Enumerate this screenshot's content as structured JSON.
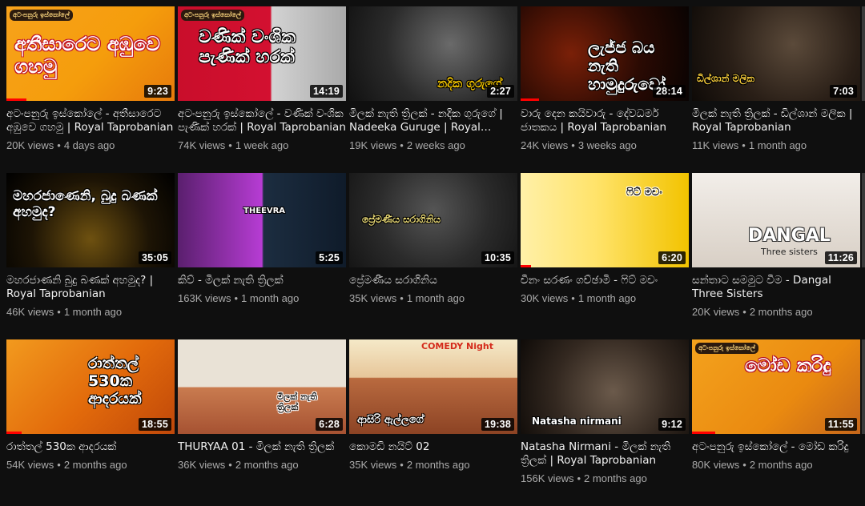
{
  "videos": [
    {
      "title": "අටංපනුරු ඉස්කෝලේ - අතීසාරෙට අඹුවෙ ගහමු | Royal Taprobanian",
      "views": "20K views",
      "age": "4 days ago",
      "duration": "9:23",
      "progress": 0.12,
      "thumb_text": "අතීසාරෙට අඹුවෙ ගහමු",
      "thumb_tag": "අටංපනුරු ඉස්කෝලේ"
    },
    {
      "title": "අටංපනුරු ඉස්කෝලේ - වණික් වංශික පැණික් හරක් | Royal Taprobanian",
      "views": "74K views",
      "age": "1 week ago",
      "duration": "14:19",
      "progress": 0.0,
      "thumb_text": "වණික් වංශික පැණික් හරක්",
      "thumb_tag": "අටංපනුරු ඉස්කෝලේ"
    },
    {
      "title": "මිලක් නැති ත්‍රිලක් - නදික ගුරුගේ | Nadeeka Guruge | Royal Taprobanian",
      "views": "19K views",
      "age": "2 weeks ago",
      "duration": "2:27",
      "progress": 0.0,
      "thumb_text": "නදික ගුරුගේ"
    },
    {
      "title": "වාරු දෙන කයිවාරු - දේවධර්ම ජාතකය | Royal Taprobanian",
      "views": "24K views",
      "age": "3 weeks ago",
      "duration": "28:14",
      "progress": 0.11,
      "thumb_text": "ලැජ්ජ බය නැති හාමුදුරුවෝ"
    },
    {
      "title": "මිලක් නැති ත්‍රිලක් - ඩිල්ශාන් මලික | Royal Taprobanian",
      "views": "11K views",
      "age": "1 month ago",
      "duration": "7:03",
      "progress": 0.0,
      "thumb_text": "ඩිල්ශාන් මලික"
    },
    {
      "title": "මහරජාණනි බුදු බණක් අහමුද? | Royal Taprobanian",
      "views": "46K views",
      "age": "1 month ago",
      "duration": "35:05",
      "progress": 0.0,
      "thumb_text": "මහරජාණෙනි, බුදු බණක් අහමුද?"
    },
    {
      "title": "කිව් - මිලක් නැති ත්‍රිලක්",
      "views": "163K views",
      "age": "1 month ago",
      "duration": "5:25",
      "progress": 0.0,
      "thumb_text": "THEEVRA"
    },
    {
      "title": "ප්‍රේමණීය සරාගිනිය",
      "views": "35K views",
      "age": "1 month ago",
      "duration": "10:35",
      "progress": 0.0,
      "thumb_text": "ප්‍රේමණීය සරාගිනිය"
    },
    {
      "title": "චීනං සරණං ගච්ඡාමි - ෆිට් මචං",
      "views": "30K views",
      "age": "1 month ago",
      "duration": "6:20",
      "progress": 0.06,
      "thumb_text": "ෆිට් මචං"
    },
    {
      "title": "සන්තාට සමමුට වීම - Dangal Three Sisters",
      "views": "20K views",
      "age": "2 months ago",
      "duration": "11:26",
      "progress": 0.0,
      "thumb_text": "DANGAL",
      "thumb_sub": "Three sisters"
    },
    {
      "title": "රාත්තල් 530ක ආදරයක්",
      "views": "54K views",
      "age": "2 months ago",
      "duration": "18:55",
      "progress": 0.09,
      "thumb_text": "රාත්තල් 530ක ආදරයක්"
    },
    {
      "title": "THURYAA 01 - මිලක් නැති ත්‍රිලක්",
      "views": "36K views",
      "age": "2 months ago",
      "duration": "6:28",
      "progress": 0.0,
      "thumb_text": "මිලක් නැති ත්‍රිලක්"
    },
    {
      "title": "කොමඩි නයිට් 02",
      "views": "35K views",
      "age": "2 months ago",
      "duration": "19:38",
      "progress": 0.0,
      "thumb_text": "ආසිරි ඇල්ලගේ",
      "thumb_top": "COMEDY Night"
    },
    {
      "title": "Natasha Nirmani - මිලක් නැති ත්‍රිලක් | Royal Taprobanian",
      "views": "156K views",
      "age": "2 months ago",
      "duration": "9:12",
      "progress": 0.0,
      "thumb_text": "Natasha nirmani"
    },
    {
      "title": "අටංපනුරු ඉස්කෝලේ - මෝඩ කරිදු",
      "views": "80K views",
      "age": "2 months ago",
      "duration": "11:55",
      "progress": 0.14,
      "thumb_text": "මෝඩ කරිදු",
      "thumb_tag": "අටංපනුරු ඉස්කෝලේ"
    }
  ],
  "separator": "•",
  "colors": {
    "progress": "#ff0000",
    "bg": "#0f0f0f",
    "meta": "#aaaaaa"
  }
}
